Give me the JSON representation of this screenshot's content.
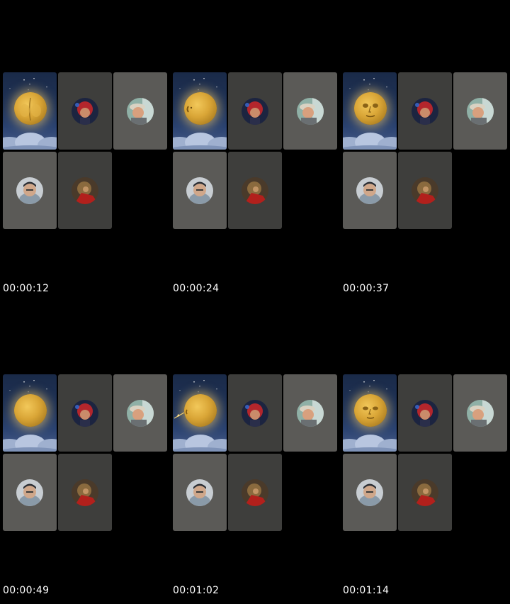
{
  "frames": [
    {
      "timestamp": "00:00:12",
      "moon_state": "back-view"
    },
    {
      "timestamp": "00:00:24",
      "moon_state": "turning"
    },
    {
      "timestamp": "00:00:37",
      "moon_state": "face"
    },
    {
      "timestamp": "00:00:49",
      "moon_state": "plain"
    },
    {
      "timestamp": "00:01:02",
      "moon_state": "turning-sparkle"
    },
    {
      "timestamp": "00:01:14",
      "moon_state": "face"
    }
  ],
  "participants": [
    {
      "icon": "moon-avatar-icon",
      "type": "moon"
    },
    {
      "icon": "red-helmet-avatar-icon",
      "type": "person"
    },
    {
      "icon": "cap-man-avatar-icon",
      "type": "person"
    },
    {
      "icon": "hooded-man-avatar-icon",
      "type": "person"
    },
    {
      "icon": "warrior-avatar-icon",
      "type": "person"
    }
  ],
  "colors": {
    "background": "#000000",
    "tile_light": "#5b5a57",
    "tile_dark": "#3e3e3c",
    "moon": "#d9a536",
    "timestamp_text": "#ffffff"
  }
}
